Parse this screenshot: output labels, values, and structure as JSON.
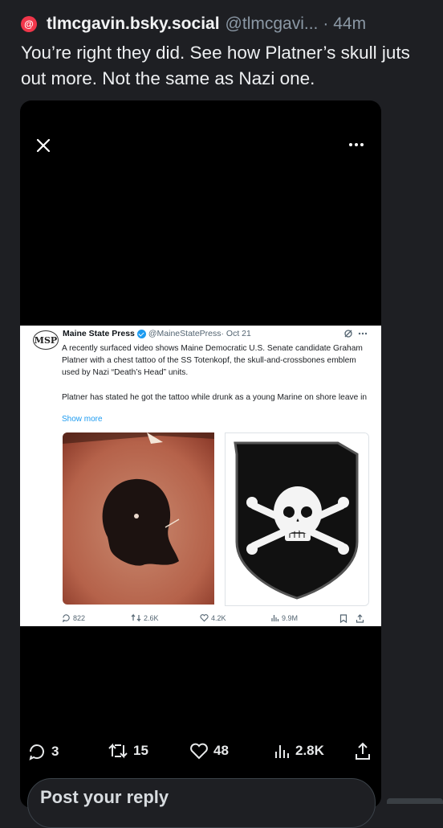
{
  "post": {
    "badge": "@",
    "author_name": "tlmcgavin.bsky.social",
    "author_handle": "@tlmcgavi...",
    "time": "· 44m",
    "text": "You’re right they did. See how Platner’s skull juts out more. Not the same as Nazi one."
  },
  "embedded_tweet": {
    "logo": "MSP",
    "name": "Maine State Press",
    "handle": "@MaineStatePress",
    "date": "· Oct 21",
    "text": "A recently surfaced video shows Maine Democratic U.S. Senate candidate Graham Platner with a chest tattoo of the SS Totenkopf, the skull-and-crossbones emblem used by Nazi “Death’s Head” units.",
    "text2": "Platner has stated he got the tattoo while drunk as a young Marine on shore leave in",
    "show_more": "Show more",
    "stats": {
      "replies": "822",
      "reposts": "2.6K",
      "likes": "4.2K",
      "views": "9.9M"
    }
  },
  "actions": {
    "replies": "3",
    "reposts": "15",
    "likes": "48",
    "views": "2.8K"
  },
  "reply_box": {
    "placeholder": "Post your reply"
  },
  "icons": [
    "bluesky-badge",
    "close-icon",
    "more-icon",
    "verified-icon",
    "grok-icon",
    "reply-icon",
    "repost-icon",
    "like-icon",
    "views-icon",
    "bookmark-icon",
    "share-icon"
  ],
  "colors": {
    "background": "#1e1f23",
    "badge": "#f0364a",
    "link": "#1d9bf0",
    "muted": "#8b98a5"
  }
}
